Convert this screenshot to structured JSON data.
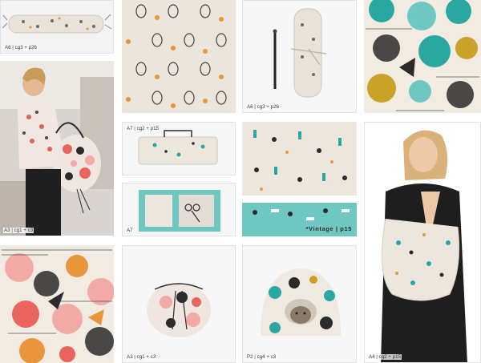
{
  "tiles": {
    "a6_roll_closed": {
      "caption": "A6 | cg3 + p26"
    },
    "woman_backpack": {
      "caption": "A3 | cg1 + c3"
    },
    "llama_pattern": {},
    "a6_roll_hook": {
      "caption": "A6 | cg3 + p26"
    },
    "a7_case_closed": {
      "caption": "A7 | cg2 + p15"
    },
    "a7_case_open": {
      "caption": "A7"
    },
    "vintage_pattern_cream": {},
    "vintage_pattern_teal": {
      "label": "*Vintage | p15"
    },
    "circles_pattern_teal": {},
    "circles_pattern_pink": {},
    "a3_drawstring_bag": {
      "caption": "A3 | cg1 + c3"
    },
    "p2_pet_cave": {
      "caption": "P2 | cg4 + c3"
    },
    "woman_shoulder_bag": {
      "caption": "A4 | cg2 + p15"
    }
  },
  "colors": {
    "linen": "#ebe5dc",
    "teal": "#2aa7a1",
    "mint": "#6fc7c1",
    "mustard": "#c9a227",
    "coral": "#e9655b",
    "pink": "#f2aaa6",
    "orange": "#e9953b",
    "charcoal": "#2b2b2b"
  }
}
